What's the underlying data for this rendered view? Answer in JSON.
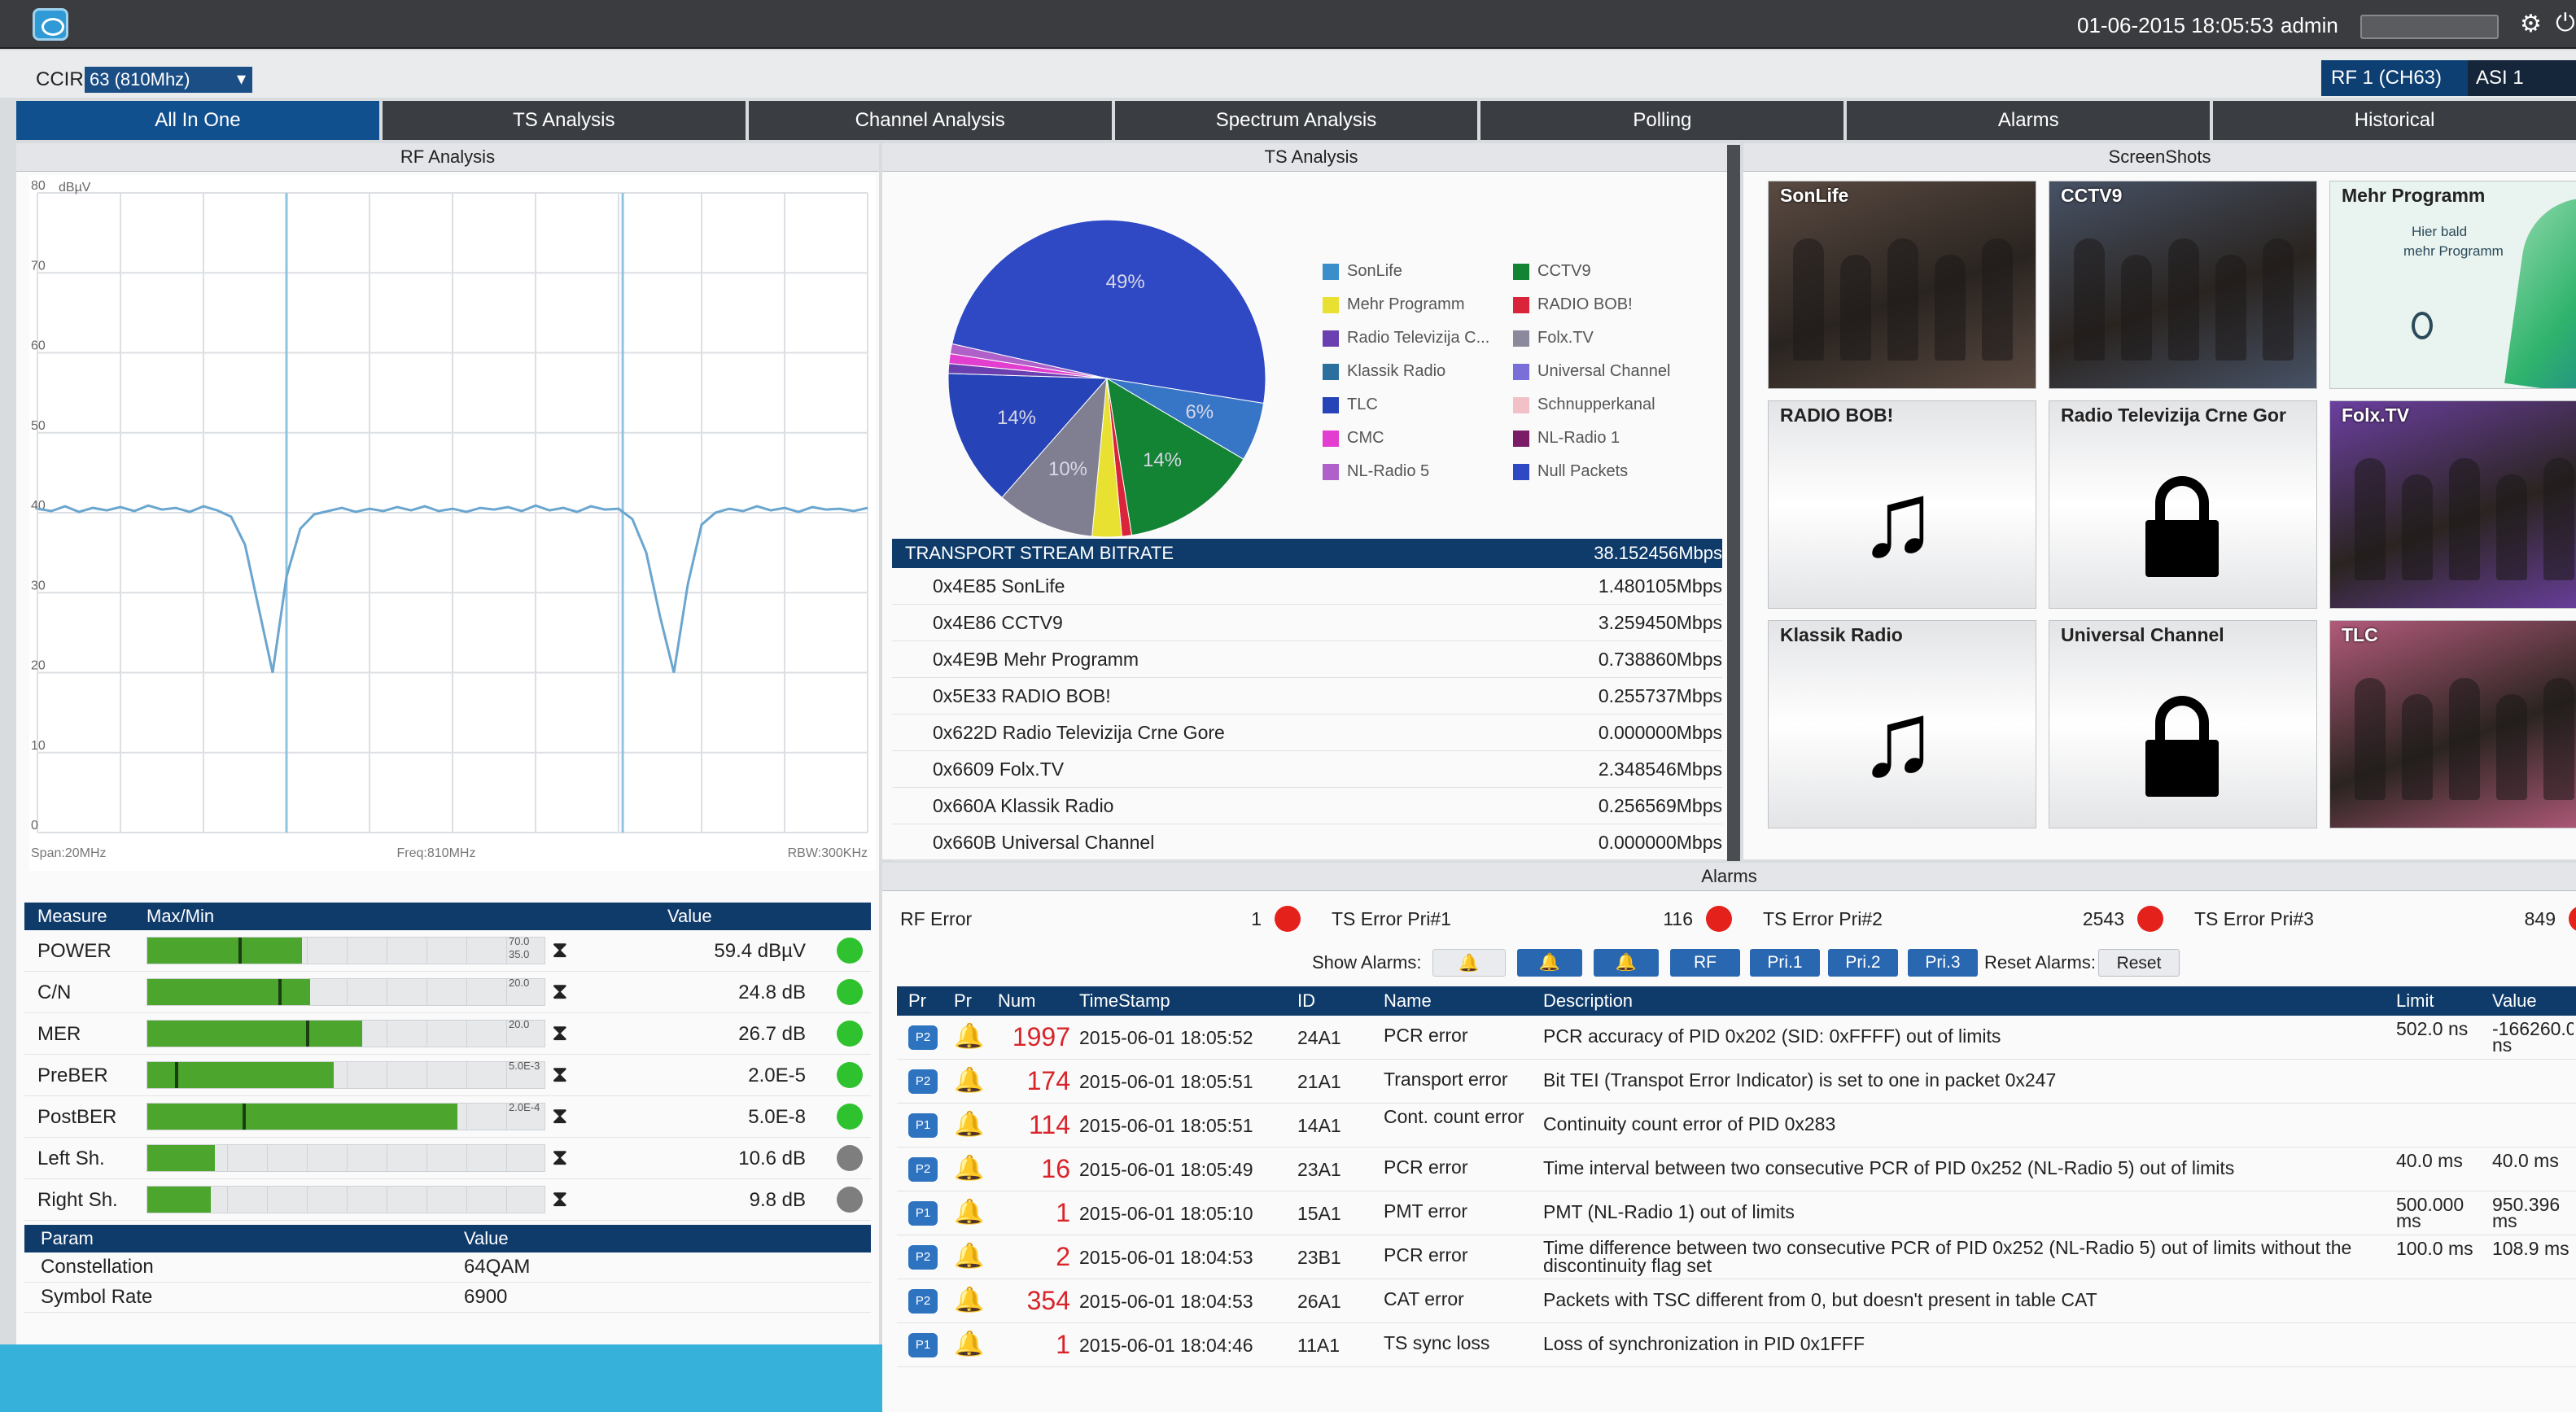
{
  "topbar": {
    "datetime": "01-06-2015 18:05:53",
    "user": "admin"
  },
  "row2": {
    "ccir_label": "CCIR",
    "ccir_value": "63 (810Mhz)",
    "rf_button": "RF 1 (CH63)",
    "asi_button": "ASI 1"
  },
  "tabs": [
    {
      "label": "All In One",
      "active": true
    },
    {
      "label": "TS Analysis"
    },
    {
      "label": "Channel Analysis"
    },
    {
      "label": "Spectrum Analysis"
    },
    {
      "label": "Polling"
    },
    {
      "label": "Alarms"
    },
    {
      "label": "Historical"
    }
  ],
  "panels": {
    "rf": "RF Analysis",
    "ts": "TS Analysis",
    "screens": "ScreenShots",
    "alarms": "Alarms"
  },
  "rf_chart": {
    "unit": "dBµV",
    "y_ticks": [
      "80",
      "70",
      "60",
      "50",
      "40",
      "30",
      "20",
      "10",
      "0"
    ],
    "span": "Span:20MHz",
    "freq": "Freq:810MHz",
    "rbw": "RBW:300KHz"
  },
  "chart_data": {
    "type": "line",
    "xlabel": "",
    "ylabel": "",
    "ylim": [
      0,
      80
    ],
    "grid": true,
    "series": [
      {
        "values": [
          40.5,
          40.2,
          40.8,
          40.1,
          40.6,
          40.3,
          40.7,
          40.2,
          40.9,
          40.4,
          40.6,
          40.1,
          40.8,
          40.3,
          39.5,
          36,
          28,
          20,
          32,
          38,
          39.8,
          40.2,
          40.6,
          40.1,
          40.5,
          40.2,
          40.7,
          40.3,
          40.8,
          40.2,
          40.5,
          40.1,
          40.6,
          40.4,
          40.7,
          40.2,
          40.9,
          40.3,
          40.6,
          40.1,
          40.8,
          40.4,
          40.5,
          39.2,
          35,
          27,
          20,
          31,
          38.5,
          40,
          40.5,
          40.2,
          40.8,
          40.3,
          40.6,
          40.1,
          40.7,
          40.4,
          40.5,
          40.2,
          40.6
        ]
      }
    ]
  },
  "measure": {
    "headers": [
      "Measure",
      "Max/Min",
      "Value"
    ],
    "rows": [
      {
        "name": "POWER",
        "fill": 0.39,
        "marker": 0.23,
        "limit_a": "70.0",
        "limit_b": "35.0",
        "value": "59.4 dBµV",
        "status": "#2fc22f"
      },
      {
        "name": "C/N",
        "fill": 0.41,
        "marker": 0.33,
        "limit_a": "20.0",
        "limit_b": "",
        "value": "24.8 dB",
        "status": "#2fc22f"
      },
      {
        "name": "MER",
        "fill": 0.54,
        "marker": 0.4,
        "limit_a": "20.0",
        "limit_b": "",
        "value": "26.7 dB",
        "status": "#2fc22f"
      },
      {
        "name": "PreBER",
        "fill": 0.47,
        "marker": 0.07,
        "limit_a": "5.0E-3",
        "limit_b": "",
        "value": "2.0E-5",
        "status": "#2fc22f"
      },
      {
        "name": "PostBER",
        "fill": 0.78,
        "marker": 0.24,
        "limit_a": "2.0E-4",
        "limit_b": "",
        "value": "5.0E-8",
        "status": "#2fc22f"
      },
      {
        "name": "Left Sh.",
        "fill": 0.17,
        "marker": null,
        "limit_a": "",
        "limit_b": "",
        "value": "10.6 dB",
        "status": "#7e7e7e"
      },
      {
        "name": "Right Sh.",
        "fill": 0.16,
        "marker": null,
        "limit_a": "",
        "limit_b": "",
        "value": "9.8 dB",
        "status": "#7e7e7e"
      }
    ]
  },
  "params": {
    "headers": [
      "Param",
      "Value"
    ],
    "rows": [
      {
        "name": "Constellation",
        "value": "64QAM"
      },
      {
        "name": "Symbol Rate",
        "value": "6900"
      }
    ]
  },
  "pie": {
    "slices": [
      {
        "name": "Null Packets",
        "value": 49,
        "color": "#2f48c4",
        "label": "49%"
      },
      {
        "name": "SonLife",
        "value": 6,
        "color": "#3776c6",
        "label": "6%"
      },
      {
        "name": "CCTV9",
        "value": 14,
        "color": "#138334",
        "label": "14%"
      },
      {
        "name": "RADIO BOB!",
        "value": 1,
        "color": "#d9243a",
        "label": ""
      },
      {
        "name": "Mehr Programm",
        "value": 3,
        "color": "#e9e131",
        "label": ""
      },
      {
        "name": "Folx.TV",
        "value": 10,
        "color": "#7f7f91",
        "label": "10%"
      },
      {
        "name": "TLC",
        "value": 14,
        "color": "#2643b8",
        "label": "14%"
      },
      {
        "name": "Radio Televizija C...",
        "value": 1,
        "color": "#6a3fb0",
        "label": ""
      },
      {
        "name": "CMC",
        "value": 1,
        "color": "#e23fd0",
        "label": ""
      },
      {
        "name": "NL-Radio 5",
        "value": 1,
        "color": "#b061c9",
        "label": ""
      }
    ],
    "legend": [
      {
        "name": "SonLife",
        "color": "#3a8fcb"
      },
      {
        "name": "CCTV9",
        "color": "#138334"
      },
      {
        "name": "Mehr Programm",
        "color": "#e9e131"
      },
      {
        "name": "RADIO BOB!",
        "color": "#d9243a"
      },
      {
        "name": "Radio Televizija C...",
        "color": "#6a3fb0"
      },
      {
        "name": "Folx.TV",
        "color": "#8a8a9c"
      },
      {
        "name": "Klassik Radio",
        "color": "#2b6f9e"
      },
      {
        "name": "Universal Channel",
        "color": "#7a6ed8"
      },
      {
        "name": "TLC",
        "color": "#2643b8"
      },
      {
        "name": "Schnupperkanal",
        "color": "#f2c1c8"
      },
      {
        "name": "CMC",
        "color": "#e23fd0"
      },
      {
        "name": "NL-Radio 1",
        "color": "#7a1c66"
      },
      {
        "name": "NL-Radio 5",
        "color": "#b061c9"
      },
      {
        "name": "Null Packets",
        "color": "#2f48c4"
      }
    ]
  },
  "bitrate": {
    "title": "TRANSPORT STREAM BITRATE",
    "total": "38.152456Mbps",
    "rows": [
      {
        "name": "0x4E85 SonLife",
        "value": "1.480105Mbps"
      },
      {
        "name": "0x4E86 CCTV9",
        "value": "3.259450Mbps"
      },
      {
        "name": "0x4E9B Mehr Programm",
        "value": "0.738860Mbps"
      },
      {
        "name": "0x5E33 RADIO BOB!",
        "value": "0.255737Mbps"
      },
      {
        "name": "0x622D Radio Televizija Crne Gore",
        "value": "0.000000Mbps"
      },
      {
        "name": "0x6609 Folx.TV",
        "value": "2.348546Mbps"
      },
      {
        "name": "0x660A Klassik Radio",
        "value": "0.256569Mbps"
      },
      {
        "name": "0x660B Universal Channel",
        "value": "0.000000Mbps"
      }
    ]
  },
  "screenshots": [
    {
      "name": "SonLife",
      "kind": "photo",
      "bg": "#5a4a42"
    },
    {
      "name": "CCTV9",
      "kind": "photo",
      "bg": "#475266"
    },
    {
      "name": "Mehr Programm",
      "kind": "mehr",
      "bg": "#e9f3ef",
      "line1": "Hier bald",
      "line2": "mehr Programm"
    },
    {
      "name": "RADIO BOB!",
      "kind": "note",
      "bg": ""
    },
    {
      "name": "Radio Televizija Crne Gor",
      "kind": "lock",
      "bg": ""
    },
    {
      "name": "Folx.TV",
      "kind": "photo",
      "bg": "#6b3fa0"
    },
    {
      "name": "Klassik Radio",
      "kind": "note",
      "bg": ""
    },
    {
      "name": "Universal Channel",
      "kind": "lock",
      "bg": ""
    },
    {
      "name": "TLC",
      "kind": "photo",
      "bg": "#b25a7a"
    }
  ],
  "alarm_summary": [
    {
      "label": "RF Error",
      "count": "1"
    },
    {
      "label": "TS Error Pri#1",
      "count": "116"
    },
    {
      "label": "TS Error Pri#2",
      "count": "2543"
    },
    {
      "label": "TS Error Pri#3",
      "count": "849"
    }
  ],
  "alarm_filters": {
    "show_label": "Show Alarms:",
    "buttons": [
      "RF",
      "Pri.1",
      "Pri.2",
      "Pri.3"
    ],
    "reset_label": "Reset Alarms:",
    "reset_button": "Reset"
  },
  "alarm_table": {
    "headers": [
      "Pr",
      "Pr",
      "Num",
      "TimeStamp",
      "ID",
      "Name",
      "Description",
      "Limit",
      "Value"
    ],
    "rows": [
      {
        "pr": "P2",
        "bell": "#e2b21a",
        "num": "1997",
        "ts": "2015-06-01 18:05:52",
        "id": "24A1",
        "name": "PCR error",
        "desc": "PCR accuracy of PID 0x202 (SID: 0xFFFF) out of limits",
        "limit": "502.0 ns",
        "value": "-166260.0 ns"
      },
      {
        "pr": "P2",
        "bell": "#e2b21a",
        "num": "174",
        "ts": "2015-06-01 18:05:51",
        "id": "21A1",
        "name": "Transport error",
        "desc": "Bit TEI (Transpot Error Indicator) is set to one in packet 0x247",
        "limit": "",
        "value": ""
      },
      {
        "pr": "P1",
        "bell": "#d8242a",
        "num": "114",
        "ts": "2015-06-01 18:05:51",
        "id": "14A1",
        "name": "Cont. count error",
        "desc": "Continuity count error of PID 0x283",
        "limit": "",
        "value": ""
      },
      {
        "pr": "P2",
        "bell": "#e2b21a",
        "num": "16",
        "ts": "2015-06-01 18:05:49",
        "id": "23A1",
        "name": "PCR error",
        "desc": "Time interval between two consecutive PCR of PID 0x252 (NL-Radio 5) out of limits",
        "limit": "40.0 ms",
        "value": "40.0 ms"
      },
      {
        "pr": "P1",
        "bell": "#d8242a",
        "num": "1",
        "ts": "2015-06-01 18:05:10",
        "id": "15A1",
        "name": "PMT error",
        "desc": "PMT (NL-Radio 1) out of limits",
        "limit": "500.000 ms",
        "value": "950.396 ms"
      },
      {
        "pr": "P2",
        "bell": "#e2b21a",
        "num": "2",
        "ts": "2015-06-01 18:04:53",
        "id": "23B1",
        "name": "PCR error",
        "desc": "Time difference between two consecutive PCR of PID 0x252 (NL-Radio 5) out of limits without the discontinuity flag set",
        "limit": "100.0 ms",
        "value": "108.9 ms"
      },
      {
        "pr": "P2",
        "bell": "#e2b21a",
        "num": "354",
        "ts": "2015-06-01 18:04:53",
        "id": "26A1",
        "name": "CAT error",
        "desc": "Packets with TSC different from 0, but doesn't present in table CAT",
        "limit": "",
        "value": ""
      },
      {
        "pr": "P1",
        "bell": "#d8242a",
        "num": "1",
        "ts": "2015-06-01 18:04:46",
        "id": "11A1",
        "name": "TS sync loss",
        "desc": "Loss of synchronization in PID 0x1FFF",
        "limit": "",
        "value": ""
      }
    ]
  }
}
